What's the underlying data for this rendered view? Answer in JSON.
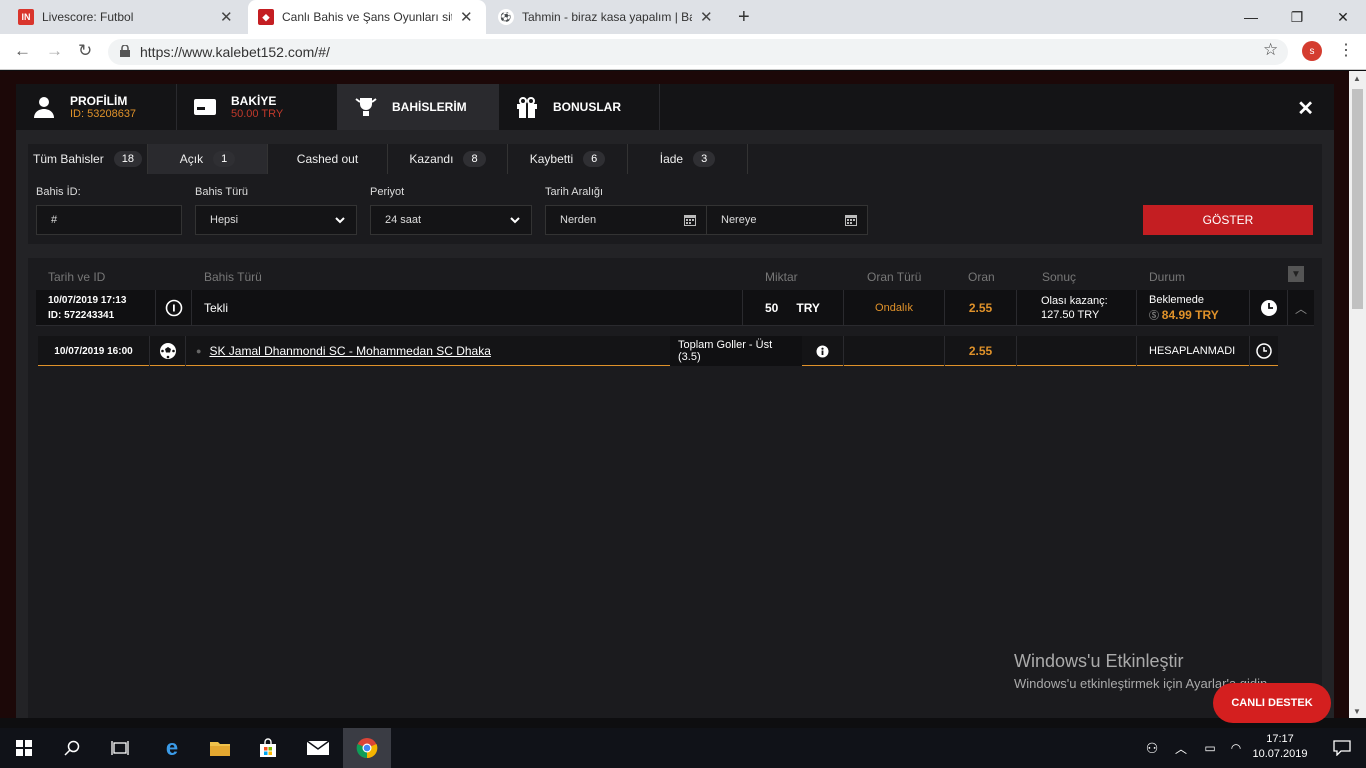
{
  "browser": {
    "tabs": [
      {
        "title": "Livescore: Futbol",
        "favicon": "IN",
        "favicon_color": "#d9352c"
      },
      {
        "title": "Canlı Bahis ve Şans Oyunları sitesi",
        "favicon": "shield-icon",
        "favicon_color": "#c41e22"
      },
      {
        "title": "Tahmin - biraz kasa yapalım | Bahis",
        "favicon": "soccer-ball-icon",
        "favicon_color": "#333"
      }
    ],
    "url": "https://www.kalebet152.com/#/",
    "avatar_letter": "s"
  },
  "modal": {
    "tabs": [
      {
        "title": "PROFİLİM",
        "subtitle": "ID: 53208637",
        "icon": "user-icon"
      },
      {
        "title": "BAKİYE",
        "subtitle": "50.00 TRY",
        "icon": "wallet-icon"
      },
      {
        "title": "BAHİSLERİM",
        "subtitle": "",
        "icon": "trophy-icon"
      },
      {
        "title": "BONUSLAR",
        "subtitle": "",
        "icon": "gift-icon"
      }
    ],
    "close_label": "✕"
  },
  "filter_tabs": [
    {
      "label": "Tüm Bahisler",
      "count": "18"
    },
    {
      "label": "Açık",
      "count": "1"
    },
    {
      "label": "Cashed out",
      "count": ""
    },
    {
      "label": "Kazandı",
      "count": "8"
    },
    {
      "label": "Kaybetti",
      "count": "6"
    },
    {
      "label": "İade",
      "count": "3"
    }
  ],
  "filters": {
    "bahis_id_label": "Bahis İD:",
    "bahis_id_value": "#",
    "bahis_turu_label": "Bahis Türü",
    "bahis_turu_value": "Hepsi",
    "periyot_label": "Periyot",
    "periyot_value": "24 saat",
    "tarih_label": "Tarih Aralığı",
    "from_value": "Nerden",
    "to_value": "Nereye",
    "submit": "GÖSTER"
  },
  "table": {
    "headers": [
      "Tarih ve ID",
      "Bahis Türü",
      "Miktar",
      "Oran Türü",
      "Oran",
      "Sonuç",
      "Durum"
    ],
    "bet": {
      "datetime": "10/07/2019 17:13",
      "id": "ID: 572243341",
      "type": "Tekli",
      "amount": "50",
      "currency": "TRY",
      "odds_type": "Ondalık",
      "odds": "2.55",
      "result_label": "Olası kazanç:",
      "result_value": "127.50 TRY",
      "status": "Beklemede",
      "cashout": "84.99 TRY"
    },
    "selection": {
      "datetime": "10/07/2019 16:00",
      "match": "SK Jamal Dhanmondi SC - Mohammedan SC Dhaka",
      "market": "Toplam Goller - Üst (3.5)",
      "odds": "2.55",
      "status": "HESAPLANMADI"
    }
  },
  "watermark": {
    "line1": "Windows'u Etkinleştir",
    "line2": "Windows'u etkinleştirmek için Ayarlar'a gidin."
  },
  "support_button": "CANLI DESTEK",
  "taskbar": {
    "time": "17:17",
    "date": "10.07.2019"
  }
}
